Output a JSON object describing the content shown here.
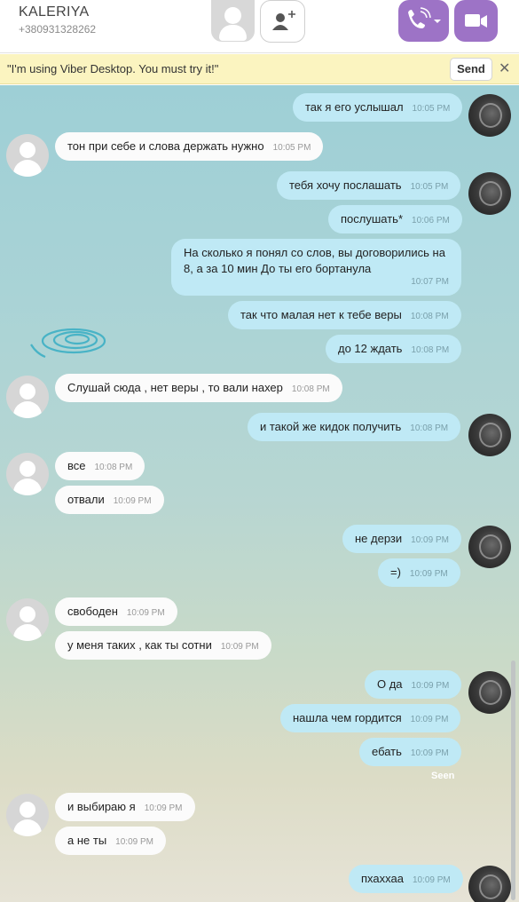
{
  "header": {
    "contact_name": "KALERIYA",
    "contact_phone": "+380931328262"
  },
  "notice": {
    "text": "\"I'm using Viber Desktop. You must try it!\"",
    "send_label": "Send",
    "close_label": "✕"
  },
  "messages": [
    {
      "text": "так я его услышал",
      "time": "10:05 PM"
    },
    {
      "text": "тон при себе и слова держать нужно",
      "time": "10:05 PM"
    },
    {
      "text": "тебя хочу послашать",
      "time": "10:05 PM"
    },
    {
      "text": "послушать*",
      "time": "10:06 PM"
    },
    {
      "text": "На сколько я понял со слов, вы договорились на 8, а за 10 мин До ты его бортанула",
      "time": "10:07 PM"
    },
    {
      "text": "так что малая нет к тебе веры",
      "time": "10:08 PM"
    },
    {
      "text": "до 12 ждать",
      "time": "10:08 PM"
    },
    {
      "text": "Слушай сюда , нет веры , то вали нахер",
      "time": "10:08 PM"
    },
    {
      "text": "и такой же кидок получить",
      "time": "10:08 PM"
    },
    {
      "text": "все",
      "time": "10:08 PM"
    },
    {
      "text": "отвали",
      "time": "10:09 PM"
    },
    {
      "text": "не дерзи",
      "time": "10:09 PM"
    },
    {
      "text": "=)",
      "time": "10:09 PM"
    },
    {
      "text": "свободен",
      "time": "10:09 PM"
    },
    {
      "text": "у меня таких , как ты сотни",
      "time": "10:09 PM"
    },
    {
      "text": "О да",
      "time": "10:09 PM"
    },
    {
      "text": "нашла чем гордится",
      "time": "10:09 PM"
    },
    {
      "text": "ебать",
      "time": "10:09 PM"
    },
    {
      "text": "и выбираю я",
      "time": "10:09 PM"
    },
    {
      "text": "а не ты",
      "time": "10:09 PM"
    },
    {
      "text": "пхаххаа",
      "time": "10:09 PM"
    }
  ],
  "seen_label": "Seen",
  "colors": {
    "accent": "#9d73c6",
    "outgoing_bubble": "#bfe9f5",
    "incoming_bubble": "#fbfbfb",
    "notice_bg": "#fbf4c0"
  },
  "icons": [
    "default-avatar-icon",
    "add-user-icon",
    "phone-icon",
    "chevron-down-icon",
    "video-camera-icon",
    "close-icon",
    "user-photo-avatar"
  ]
}
